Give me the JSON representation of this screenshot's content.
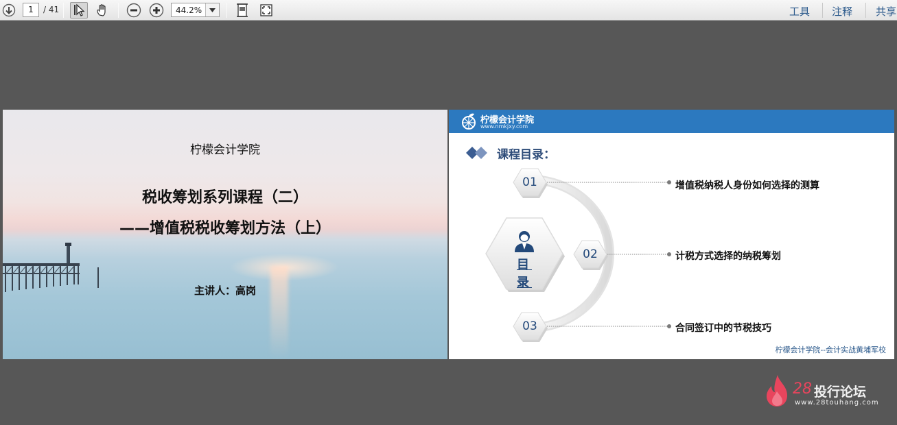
{
  "toolbar": {
    "page_current": "1",
    "page_total": "/ 41",
    "zoom": "44.2%",
    "right_links": [
      "工具",
      "注释",
      "共享"
    ]
  },
  "slide1": {
    "org": "柠檬会计学院",
    "title": "税收筹划系列课程（二）",
    "subtitle": "——增值税税收筹划方法（上）",
    "speaker": "主讲人：高岗"
  },
  "slide2": {
    "logo_name": "柠檬会计学院",
    "logo_url": "www.nmkjxy.com",
    "heading": "课程目录：",
    "center_label": "目 录",
    "items": [
      {
        "num": "01",
        "text": "增值税纳税人身份如何选择的测算"
      },
      {
        "num": "02",
        "text": "计税方式选择的纳税筹划"
      },
      {
        "num": "03",
        "text": "合同签订中的节税技巧"
      }
    ],
    "footer": "柠檬会计学院--会计实战黄埔军校"
  },
  "watermark": {
    "number": "28",
    "name": "投行论坛",
    "url": "www.28touhang.com"
  },
  "colors": {
    "accent_blue": "#2c79bf",
    "heading_navy": "#2f4d7a",
    "watermark_red": "#e8455d"
  }
}
